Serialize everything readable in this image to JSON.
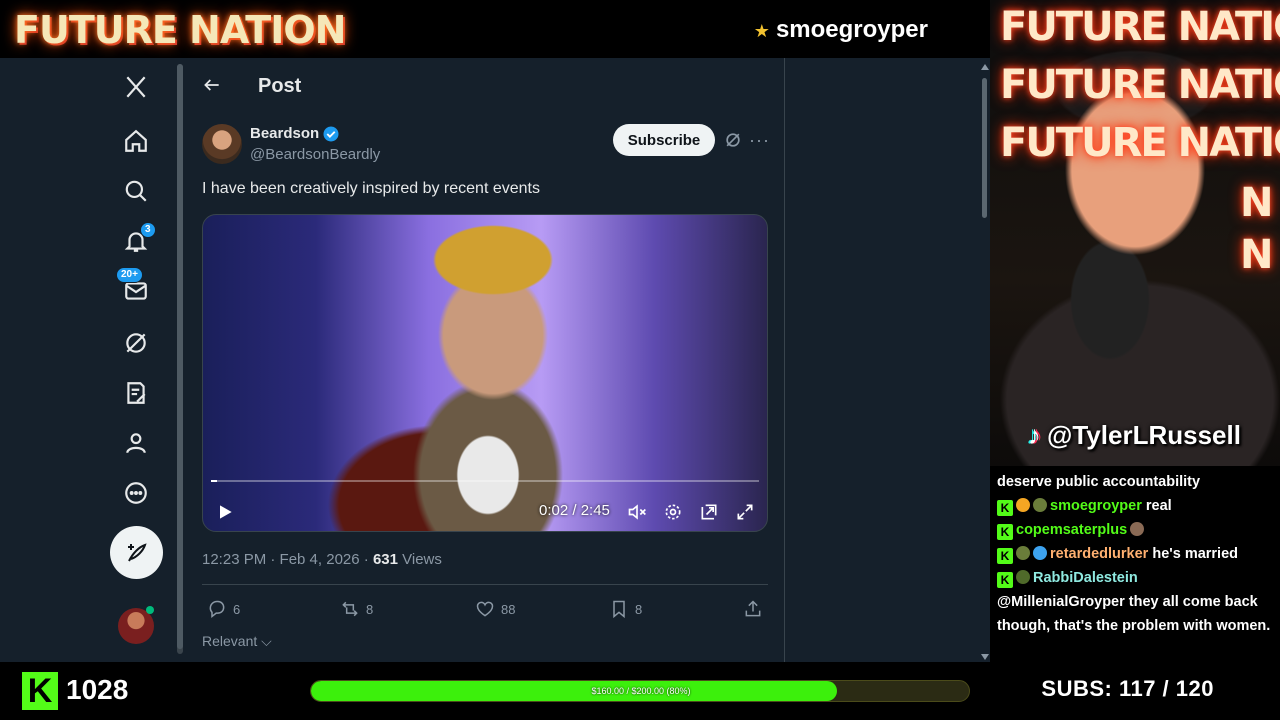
{
  "stream": {
    "brand": "FUTURE NATION",
    "streamer": "smoegroyper",
    "followers": "1028",
    "goal": {
      "text": "$160.00 / $200.00 (80%)",
      "progress_percent": 80
    },
    "subs": "SUBS:  117 / 120",
    "tiktok_handle": "@TylerLRussell",
    "webcam_neon": [
      "FUTURE NATION",
      "FUTURE NATION",
      "FUTURE NATION",
      "N",
      "N"
    ]
  },
  "sidebar": {
    "notifications_badge": "3",
    "messages_badge": "20+"
  },
  "post": {
    "header_title": "Post",
    "author_name": "Beardson",
    "author_handle": "@BeardsonBeardly",
    "subscribe_label": "Subscribe",
    "text": "I have been creatively inspired by recent events",
    "video": {
      "time": "0:02 / 2:45"
    },
    "meta_time": "12:23 PM · Feb 4, 2026 · ",
    "views_count": "631",
    "views_label": " Views",
    "actions": {
      "replies": "6",
      "reposts": "8",
      "likes": "88",
      "bookmarks": "8"
    },
    "sort_label": "Relevant"
  },
  "chat": {
    "line0": "deserve public accountability",
    "line1_user": "smoegroyper",
    "line1_msg": " real",
    "line2_user": "copemsaterplus",
    "line3_user": "retardedlurker",
    "line3_msg": " he's married",
    "line4_user": "RabbiDalestein",
    "line5": "@MillenialGroyper they all come back though, that's the problem with women."
  },
  "colors": {
    "x_bg": "#15202b",
    "kick_green": "#53fc18",
    "verified": "#1d9bf0"
  }
}
